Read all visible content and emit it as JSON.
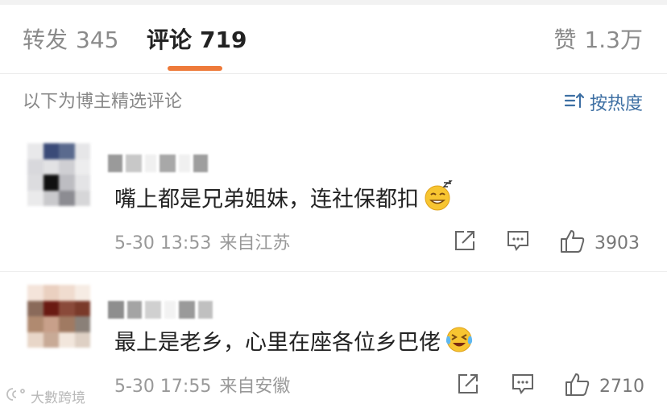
{
  "tabs": {
    "repost": {
      "label": "转发",
      "count": "345"
    },
    "comments": {
      "label": "评论",
      "count": "719"
    },
    "likes": {
      "label": "赞",
      "count": "1.3万"
    },
    "accent_color": "#ee7a3a"
  },
  "section": {
    "title": "以下为博主精选评论",
    "sort_label": "按热度",
    "sort_icon": "sort-icon",
    "link_color": "#3d6fa3"
  },
  "comments": [
    {
      "text": "嘴上都是兄弟姐妹，连社保都扣",
      "emoji": "sweat-smile-emoji",
      "date_time": "5-30 13:53",
      "location": "来自江苏",
      "likes": "3903",
      "actions": [
        "share-icon",
        "comment-icon",
        "like-icon"
      ]
    },
    {
      "text": "最上是老乡，心里在座各位乡巴佬",
      "emoji": "laugh-cry-emoji",
      "date_time": "5-30 17:55",
      "location": "来自安徽",
      "likes": "2710",
      "actions": [
        "share-icon",
        "comment-icon",
        "like-icon"
      ]
    }
  ],
  "watermark": {
    "text": "大數跨境"
  }
}
